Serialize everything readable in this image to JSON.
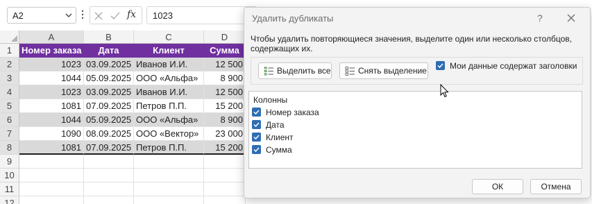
{
  "formula_bar": {
    "name_box": "A2",
    "fx_label": "fx",
    "formula_value": "1023"
  },
  "grid": {
    "column_headers": [
      "A",
      "B",
      "C",
      "D"
    ],
    "row_numbers": [
      "1",
      "2",
      "3",
      "4",
      "5",
      "6",
      "7",
      "8",
      "9",
      "10",
      "11",
      "12"
    ],
    "header_row": [
      "Номер заказа",
      "Дата",
      "Клиент",
      "Сумма"
    ],
    "rows": [
      [
        "1023",
        "03.09.2025",
        "Иванов И.И.",
        "12 500"
      ],
      [
        "1044",
        "05.09.2025",
        "ООО «Альфа»",
        "8 900"
      ],
      [
        "1023",
        "03.09.2025",
        "Иванов И.И.",
        "12 500"
      ],
      [
        "1081",
        "07.09.2025",
        "Петров П.П.",
        "15 200"
      ],
      [
        "1044",
        "05.09.2025",
        "ООО «Альфа»",
        "8 900"
      ],
      [
        "1090",
        "08.09.2025",
        "ООО «Вектор»",
        "23 000"
      ],
      [
        "1081",
        "07.09.2025",
        "Петров П.П.",
        "15 200"
      ]
    ],
    "header_color": "#7030a0",
    "shade_color": "#d9d9d9"
  },
  "dialog": {
    "title": "Удалить дубликаты",
    "help": "?",
    "instruction": "Чтобы удалить повторяющиеся значения, выделите один или несколько столбцов, содержащих их.",
    "select_all": "Выделить все",
    "unselect_all": "Снять выделение",
    "has_headers_label": "Мои данные содержат заголовки",
    "has_headers_checked": true,
    "columns_title": "Колонны",
    "columns": [
      {
        "label": "Номер заказа",
        "checked": true
      },
      {
        "label": "Дата",
        "checked": true
      },
      {
        "label": "Клиент",
        "checked": true
      },
      {
        "label": "Сумма",
        "checked": true
      }
    ],
    "ok": "ОК",
    "cancel": "Отмена",
    "accent": "#2f6db3"
  }
}
